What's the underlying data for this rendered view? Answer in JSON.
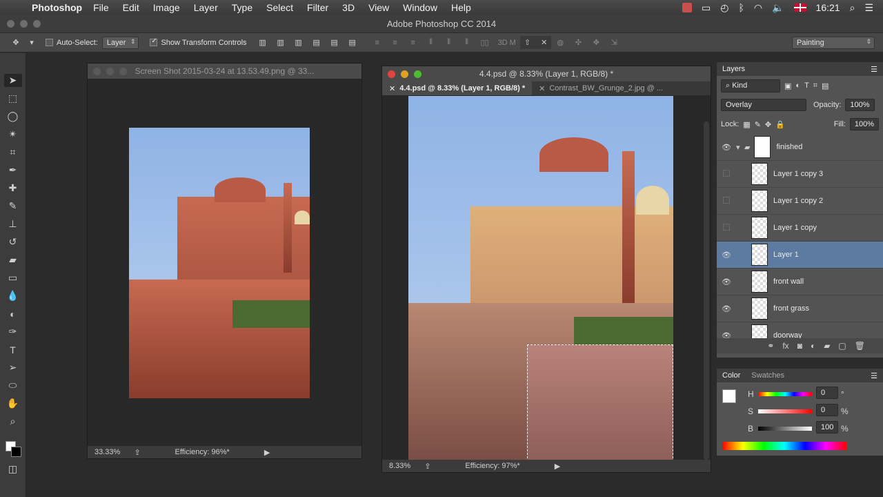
{
  "menubar": {
    "app_name": "Photoshop",
    "menus": [
      "File",
      "Edit",
      "Image",
      "Layer",
      "Type",
      "Select",
      "Filter",
      "3D",
      "View",
      "Window",
      "Help"
    ],
    "clock": "16:21"
  },
  "window_title": "Adobe Photoshop CC 2014",
  "options_bar": {
    "auto_select_label": "Auto-Select:",
    "auto_select_value": "Layer",
    "show_transform_label": "Show Transform Controls",
    "mode_3d": "3D M",
    "workspace": "Painting"
  },
  "doc_left": {
    "title": "Screen Shot 2015-03-24 at 13.53.49.png @ 33...",
    "zoom": "33.33%",
    "efficiency": "Efficiency: 96%*"
  },
  "doc_right": {
    "title": "4.4.psd @ 8.33% (Layer 1, RGB/8) *",
    "tabs": [
      "4.4.psd @ 8.33% (Layer 1, RGB/8) *",
      "Contrast_BW_Grunge_2.jpg @ ..."
    ],
    "zoom": "8.33%",
    "efficiency": "Efficiency: 97%*"
  },
  "layers_panel": {
    "title": "Layers",
    "filter": "Kind",
    "blend_mode": "Overlay",
    "opacity_label": "Opacity:",
    "opacity_value": "100%",
    "lock_label": "Lock:",
    "fill_label": "Fill:",
    "fill_value": "100%",
    "layers": [
      {
        "name": "finished",
        "visible": true
      },
      {
        "name": "Layer 1 copy 3",
        "visible": false
      },
      {
        "name": "Layer 1 copy 2",
        "visible": false
      },
      {
        "name": "Layer 1 copy",
        "visible": false
      },
      {
        "name": "Layer 1",
        "visible": true
      },
      {
        "name": "front wall",
        "visible": true
      },
      {
        "name": "front grass",
        "visible": true
      },
      {
        "name": "doorway",
        "visible": true
      }
    ]
  },
  "color_panel": {
    "tabs": [
      "Color",
      "Swatches"
    ],
    "h_label": "H",
    "h_value": "0",
    "h_unit": "°",
    "s_label": "S",
    "s_value": "0",
    "s_unit": "%",
    "b_label": "B",
    "b_value": "100",
    "b_unit": "%"
  }
}
